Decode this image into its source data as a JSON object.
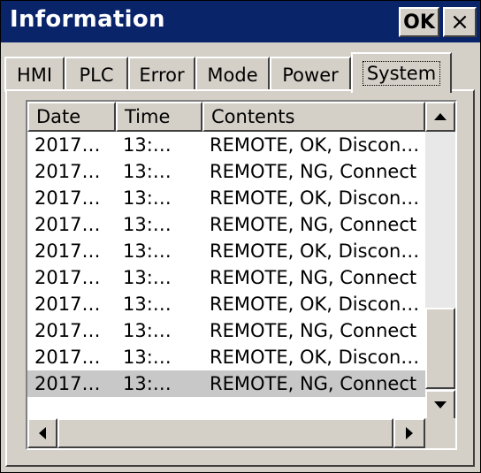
{
  "window": {
    "title": "Information",
    "ok_label": "OK",
    "close_label": "×"
  },
  "tabs": [
    {
      "label": "HMI",
      "active": false
    },
    {
      "label": "PLC",
      "active": false
    },
    {
      "label": "Error",
      "active": false
    },
    {
      "label": "Mode",
      "active": false
    },
    {
      "label": "Power",
      "active": false
    },
    {
      "label": "System",
      "active": true
    }
  ],
  "list": {
    "columns": [
      "Date",
      "Time",
      "Contents"
    ],
    "rows": [
      [
        "2017…",
        "13:…",
        "REMOTE, OK, Discon…"
      ],
      [
        "2017…",
        "13:…",
        "REMOTE, NG, Connect"
      ],
      [
        "2017…",
        "13:…",
        "REMOTE, OK, Discon…"
      ],
      [
        "2017…",
        "13:…",
        "REMOTE, NG, Connect"
      ],
      [
        "2017…",
        "13:…",
        "REMOTE, OK, Discon…"
      ],
      [
        "2017…",
        "13:…",
        "REMOTE, NG, Connect"
      ],
      [
        "2017…",
        "13:…",
        "REMOTE, OK, Discon…"
      ],
      [
        "2017…",
        "13:…",
        "REMOTE, NG, Connect"
      ],
      [
        "2017…",
        "13:…",
        "REMOTE, OK, Discon…"
      ],
      [
        "2017…",
        "13:…",
        "REMOTE, NG, Connect"
      ]
    ],
    "selected_row": 9
  }
}
